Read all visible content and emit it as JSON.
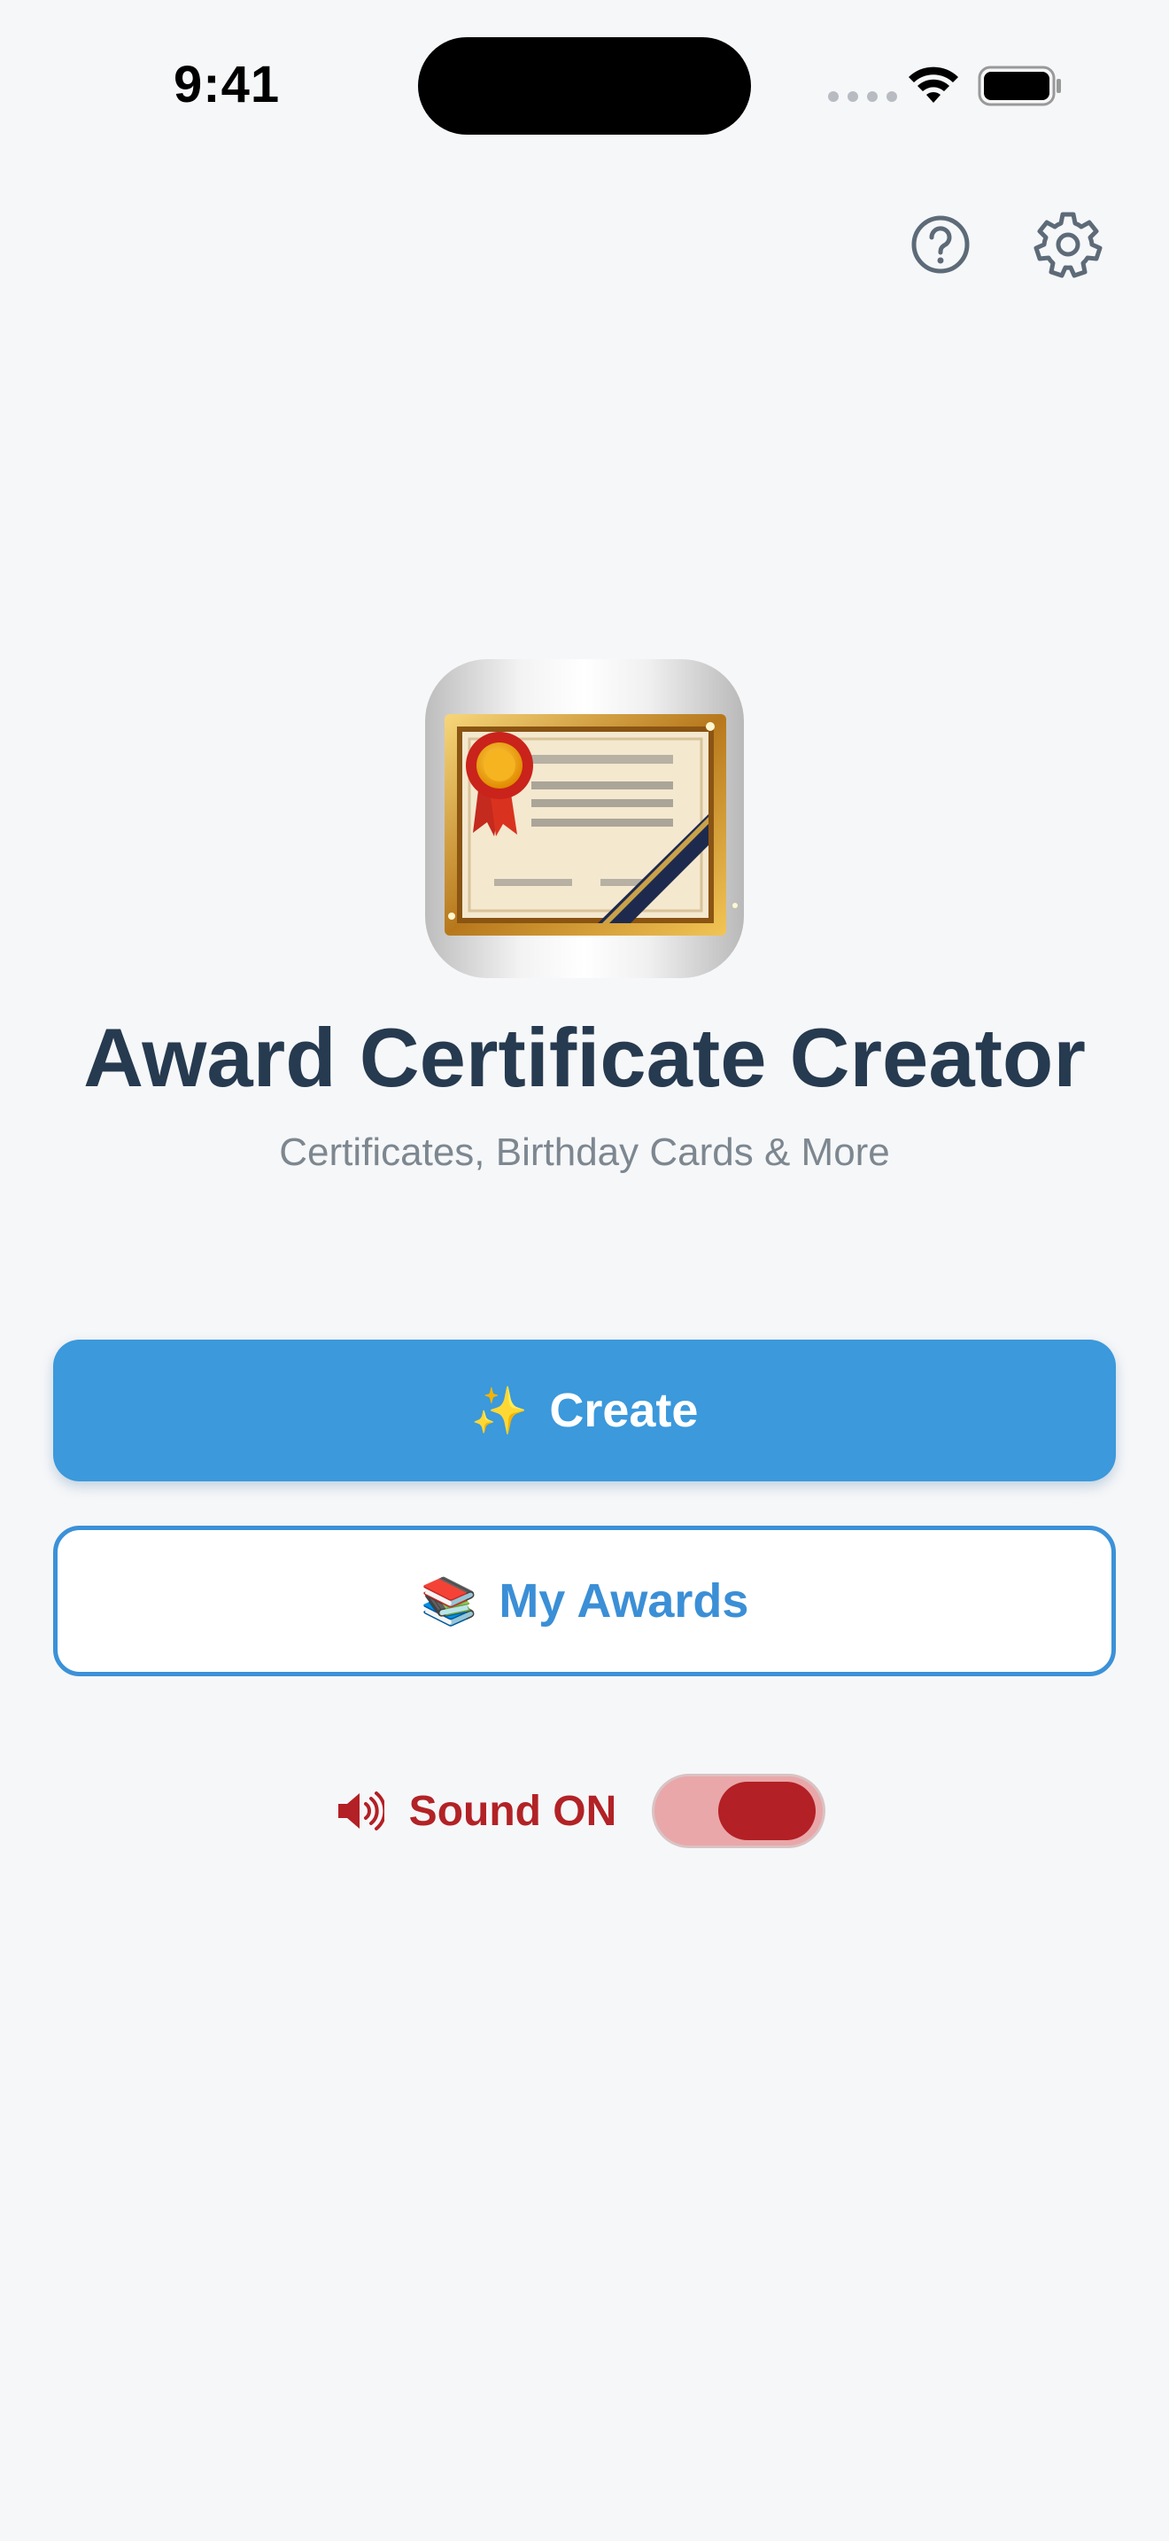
{
  "status_bar": {
    "time": "9:41"
  },
  "header": {
    "help_icon": "question-circle-icon",
    "settings_icon": "gear-icon"
  },
  "app": {
    "icon": "certificate-icon",
    "title": "Award Certificate Creator",
    "subtitle": "Certificates, Birthday Cards & More"
  },
  "actions": {
    "create_emoji": "✨",
    "create_label": "Create",
    "awards_emoji": "📚",
    "awards_label": "My Awards"
  },
  "sound": {
    "icon": "speaker-icon",
    "label": "Sound ON",
    "enabled": true
  },
  "colors": {
    "primary": "#3b99dc",
    "title": "#263a50",
    "subtitle": "#7d8790",
    "sound_accent": "#b32025",
    "background": "#f6f7f9"
  }
}
